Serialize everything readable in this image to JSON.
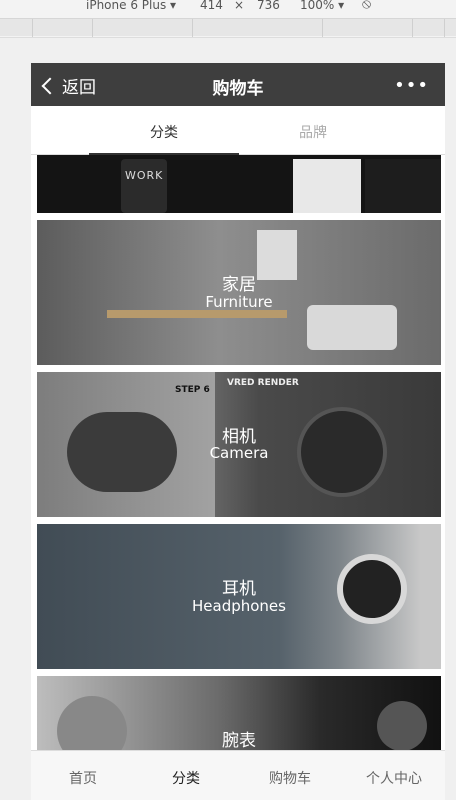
{
  "devtools": {
    "device": "iPhone 6 Plus ▾",
    "width": "414",
    "times": "×",
    "height": "736",
    "zoom": "100% ▾",
    "rotate_icon": "rotate-icon"
  },
  "nav": {
    "back_label": "返回",
    "title": "购物车",
    "more": "•••"
  },
  "tabs": [
    {
      "label": "分类",
      "active": true
    },
    {
      "label": "品牌",
      "active": false
    }
  ],
  "categories": [
    {
      "zh": "",
      "en": ""
    },
    {
      "zh": "家居",
      "en": "Furniture"
    },
    {
      "zh": "相机",
      "en": "Camera"
    },
    {
      "zh": "耳机",
      "en": "Headphones"
    },
    {
      "zh": "腕表",
      "en": ""
    }
  ],
  "banner_text": {
    "work": "WORK",
    "step": "STEP 6",
    "vred": "VRED RENDER"
  },
  "tabbar": [
    {
      "label": "首页",
      "active": false
    },
    {
      "label": "分类",
      "active": true
    },
    {
      "label": "购物车",
      "active": false
    },
    {
      "label": "个人中心",
      "active": false
    }
  ]
}
